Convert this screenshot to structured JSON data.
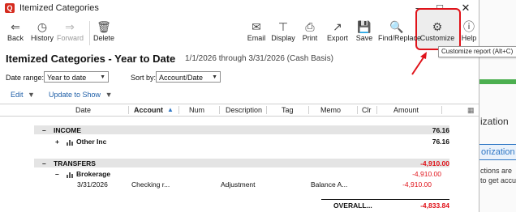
{
  "window": {
    "title": "Itemized Categories"
  },
  "toolbar": {
    "back": "Back",
    "history": "History",
    "forward": "Forward",
    "delete": "Delete",
    "email": "Email",
    "display": "Display",
    "print": "Print",
    "export": "Export",
    "save": "Save",
    "find_replace": "Find/Replace",
    "customize": "Customize",
    "help": "Help"
  },
  "tooltip": "Customize report (Alt+C)",
  "report": {
    "title": "Itemized Categories - Year to Date",
    "subtitle": "1/1/2026 through 3/31/2026 (Cash Basis)",
    "date_range_label": "Date range:",
    "date_range_value": "Year to date",
    "sort_by_label": "Sort by:",
    "sort_by_value": "Account/Date",
    "edit": "Edit",
    "update_to_show": "Update to Show"
  },
  "columns": [
    "Date",
    "Account",
    "Num",
    "Description",
    "Tag",
    "Memo",
    "Clr",
    "Amount"
  ],
  "rows": {
    "income": {
      "label": "INCOME",
      "total": "76.16"
    },
    "other_inc": {
      "label": "Other Inc",
      "amount": "76.16"
    },
    "transfers": {
      "label": "TRANSFERS",
      "total": "-4,910.00"
    },
    "brokerage": {
      "label": "Brokerage",
      "amount": "-4,910.00"
    },
    "txn": {
      "date": "3/31/2026",
      "account": "Checking r...",
      "description": "Adjustment",
      "memo": "Balance A...",
      "amount": "-4,910.00"
    },
    "overall": {
      "label": "OVERALL...",
      "total": "-4,833.84"
    }
  },
  "background_app": {
    "text1": "ization",
    "button": "orization",
    "text2": "ctions are",
    "text3": "to get accura"
  },
  "colors": {
    "accent_red": "#e0131a",
    "link_blue": "#1f5fa8",
    "green_bar": "#4caf50"
  }
}
